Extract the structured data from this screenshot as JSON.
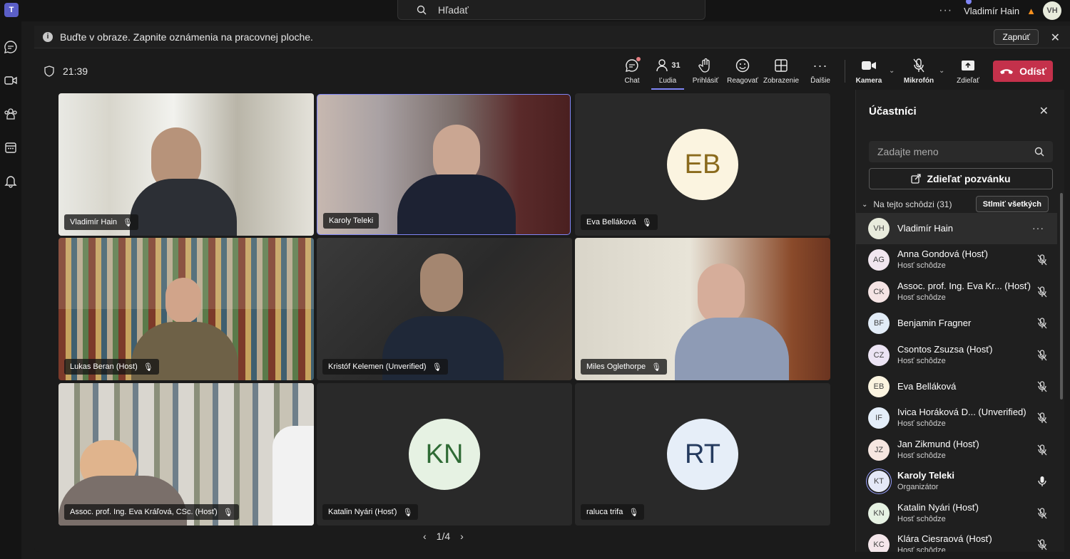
{
  "top": {
    "search_placeholder": "Hľadať",
    "user_name": "Vladimír Hain",
    "user_initials": "VH"
  },
  "banner": {
    "text": "Buďte v obraze. Zapnite oznámenia na pracovnej ploche.",
    "button": "Zapnúť"
  },
  "meeting": {
    "timer": "21:39",
    "toolbar": {
      "chat": "Chat",
      "people": "Ľudia",
      "people_count": "31",
      "raise": "Prihlásiť",
      "react": "Reagovať",
      "view": "Zobrazenie",
      "more": "Ďalšie",
      "camera": "Kamera",
      "mic": "Mikrofón",
      "share": "Zdieľať",
      "leave": "Odísť"
    },
    "tiles": [
      {
        "name": "Vladimír Hain",
        "type": "video"
      },
      {
        "name": "Karoly Teleki",
        "type": "video",
        "selected": true
      },
      {
        "name": "Eva Belláková",
        "type": "avatar",
        "initials": "EB"
      },
      {
        "name": "Lukas Beran (Host)",
        "type": "video"
      },
      {
        "name": "Kristóf Kelemen (Unverified)",
        "type": "video"
      },
      {
        "name": "Miles Oglethorpe",
        "type": "video"
      },
      {
        "name": "Assoc. prof. Ing. Eva Kráľová, CSc. (Hosť)",
        "type": "video"
      },
      {
        "name": "Katalin Nyári (Hosť)",
        "type": "avatar",
        "initials": "KN"
      },
      {
        "name": "raluca trifa",
        "type": "avatar",
        "initials": "RT"
      }
    ],
    "pager": "1/4"
  },
  "panel": {
    "title": "Účastníci",
    "search_placeholder": "Zadajte meno",
    "invite": "Zdieľať pozvánku",
    "section": "Na tejto schôdzi (31)",
    "mute_all": "Stlmiť všetkých",
    "participants": [
      {
        "initials": "VH",
        "name": "Vladimír Hain",
        "role": "",
        "me": true
      },
      {
        "initials": "AG",
        "name": "Anna Gondová (Hosť)",
        "role": "Hosť schôdze"
      },
      {
        "initials": "CK",
        "name": "Assoc. prof. Ing. Eva Kr...  (Hosť)",
        "role": "Hosť schôdze"
      },
      {
        "initials": "BF",
        "name": "Benjamin Fragner",
        "role": ""
      },
      {
        "initials": "CZ",
        "name": "Csontos Zsuzsa (Hosť)",
        "role": "Hosť schôdze"
      },
      {
        "initials": "EB",
        "name": "Eva Belláková",
        "role": ""
      },
      {
        "initials": "IF",
        "name": "Ivica Horáková D...  (Unverified)",
        "role": "Hosť schôdze"
      },
      {
        "initials": "JZ",
        "name": "Jan Zikmund (Hosť)",
        "role": "Hosť schôdze"
      },
      {
        "initials": "KT",
        "name": "Karoly Teleki",
        "role": "Organizátor",
        "organizer": true
      },
      {
        "initials": "KN",
        "name": "Katalin Nyári (Hosť)",
        "role": "Hosť schôdze"
      },
      {
        "initials": "KC",
        "name": "Klára Ciesraová (Hosť)",
        "role": "Hosť schôdze"
      }
    ]
  },
  "colors": {
    "accent": "#7f85f5",
    "leave": "#c4314b",
    "panel_bg": "#1f1f1f"
  }
}
